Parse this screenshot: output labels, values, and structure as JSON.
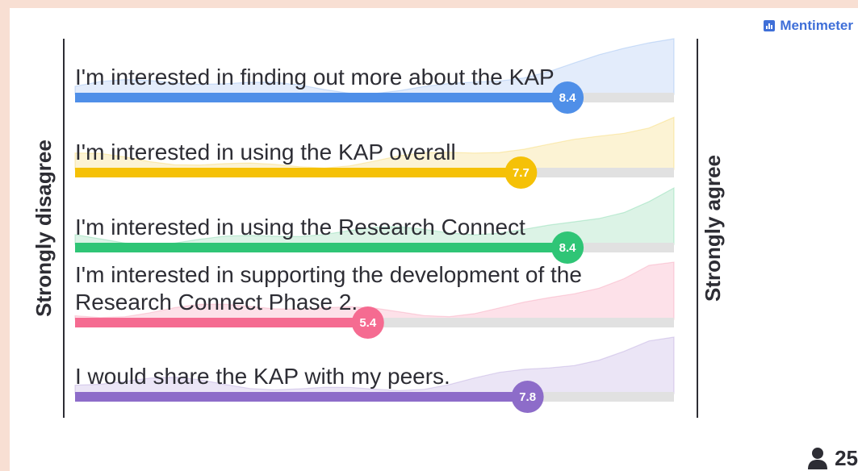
{
  "brand": {
    "name": "Mentimeter"
  },
  "participants": {
    "count": "25",
    "icon": "person-icon"
  },
  "chart_data": {
    "type": "bar",
    "scale": {
      "min": 1,
      "max": 10
    },
    "left_label": "Strongly disagree",
    "right_label": "Strongly agree",
    "items": [
      {
        "statement": [
          "I'm interested in finding out more about the KAP"
        ],
        "value": 8.4,
        "label": "8.4",
        "color": "#4f8fe8",
        "fill": "#e3ecfb"
      },
      {
        "statement": [
          "I'm interested in using the KAP overall"
        ],
        "value": 7.7,
        "label": "7.7",
        "color": "#f5c107",
        "fill": "#fcf3d4"
      },
      {
        "statement": [
          "I'm interested in using the Research Connect"
        ],
        "value": 8.4,
        "label": "8.4",
        "color": "#2fc576",
        "fill": "#dcf3e6"
      },
      {
        "statement": [
          "I'm interested in supporting the development of the",
          "Research Connect Phase 2."
        ],
        "value": 5.4,
        "label": "5.4",
        "color": "#f56b91",
        "fill": "#fde1e9"
      },
      {
        "statement": [
          "I would share the KAP with my peers."
        ],
        "value": 7.8,
        "label": "7.8",
        "color": "#8d6cc9",
        "fill": "#ebe5f6"
      }
    ]
  }
}
